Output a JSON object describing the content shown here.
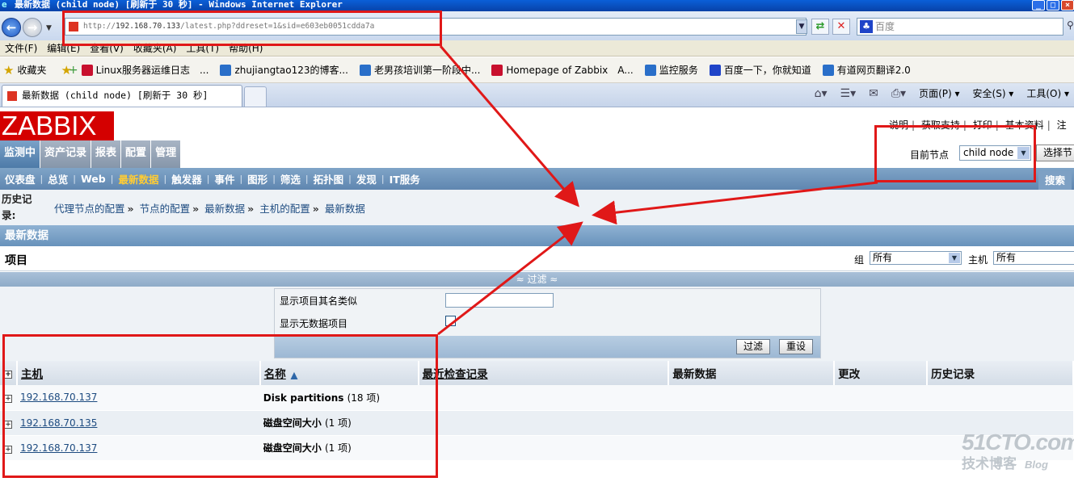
{
  "window": {
    "title": "最新数据 (child node) [刷新于 30 秒] - Windows Internet Explorer",
    "controls": [
      "_",
      "□",
      "×"
    ]
  },
  "address": {
    "url_prefix": "http://",
    "url_host": "192.168.70.133",
    "url_path": "/latest.php?ddreset=1&sid=e603eb0051cdda7a",
    "search_placeholder": "百度"
  },
  "menubar": [
    "文件(F)",
    "编辑(E)",
    "查看(V)",
    "收藏夹(A)",
    "工具(T)",
    "帮助(H)"
  ],
  "favorites": {
    "label": "收藏夹",
    "items": [
      {
        "label": "Linux服务器运维日志　...",
        "color": "#c8102e"
      },
      {
        "label": "zhujiangtao123的博客...",
        "color": "#2a6fc9"
      },
      {
        "label": "老男孩培训第一阶段中...",
        "color": "#2a6fc9"
      },
      {
        "label": "Homepage of Zabbix　A...",
        "color": "#c8102e"
      },
      {
        "label": "监控服务",
        "color": "#2a6fc9"
      },
      {
        "label": "百度一下，你就知道",
        "color": "#1f44c8"
      },
      {
        "label": "有道网页翻译2.0",
        "color": "#2a6fc9"
      }
    ]
  },
  "tab": {
    "title": "最新数据 (child node) [刷新于 30 秒]"
  },
  "commandbar": {
    "page": "页面(P) ▾",
    "safety": "安全(S) ▾",
    "tools": "工具(O) ▾"
  },
  "zabbix": {
    "logo": "ZABBIX",
    "toplinks": [
      "说明",
      "获取支持",
      "打印",
      "基本资料",
      "注"
    ],
    "mainmenu": [
      "监测中",
      "资产记录",
      "报表",
      "配置",
      "管理"
    ],
    "current_node_label": "目前节点",
    "current_node_value": "child node",
    "select_node_button": "选择节",
    "submenu": [
      "仪表盘",
      "总览",
      "Web",
      "最新数据",
      "触发器",
      "事件",
      "图形",
      "筛选",
      "拓扑图",
      "发现",
      "IT服务"
    ],
    "search_label": "搜索",
    "history_label": "历史记录:",
    "breadcrumbs": [
      "代理节点的配置",
      "节点的配置",
      "最新数据",
      "主机的配置",
      "最新数据"
    ],
    "section_title": "最新数据",
    "items_title": "项目",
    "group_label": "组",
    "group_value": "所有",
    "host_label": "主机",
    "host_value": "所有",
    "filter_toggle": "≈ 过滤 ≈",
    "filter_name_label": "显示项目其名类似",
    "filter_name_value": "",
    "filter_nodata_label": "显示无数据项目",
    "filter_button": "过滤",
    "reset_button": "重设",
    "table": {
      "headers": [
        "主机",
        "名称",
        "最近检查记录",
        "最新数据",
        "更改",
        "历史记录"
      ],
      "rows": [
        {
          "host": "192.168.70.137",
          "name": "Disk partitions",
          "count": "(18 项)"
        },
        {
          "host": "192.168.70.135",
          "name": "磁盘空间大小",
          "count": "(1 项)"
        },
        {
          "host": "192.168.70.137",
          "name": "磁盘空间大小",
          "count": "(1 项)"
        }
      ]
    }
  },
  "watermark": {
    "site": "51CTO.com",
    "tagline": "技术博客",
    "blog": "Blog"
  },
  "annotation_color": "#e01818"
}
